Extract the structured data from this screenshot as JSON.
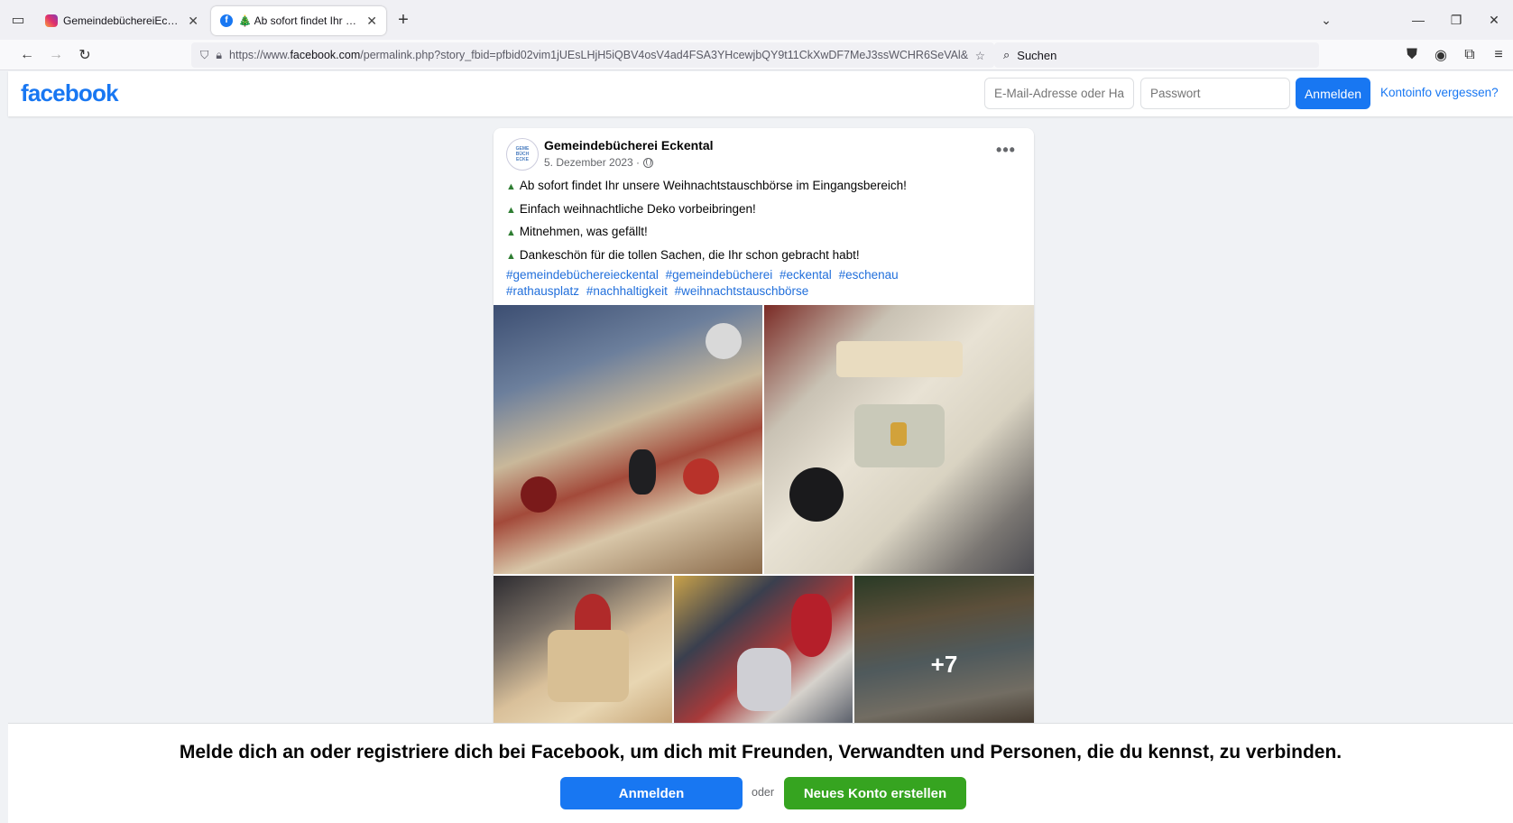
{
  "browser": {
    "tabs": [
      {
        "title": "GemeindebüchereiEckental | 🎄 ",
        "favicon": "instagram-icon",
        "active": false
      },
      {
        "title": "🎄 Ab sofort findet Ihr unsere...",
        "favicon": "facebook-icon",
        "active": true
      }
    ],
    "url_prefix": "https://www.",
    "url_domain": "facebook.com",
    "url_rest": "/permalink.php?story_fbid=pfbid02vim1jUEsLHjH5iQBV4osV4ad4FSA3YHcewjbQY9t11CkXwDF7MeJ3ssWCHR6SeVAl&id",
    "search_placeholder": "Suchen",
    "icons": {
      "tab_list": "tab-list-icon",
      "back": "back-arrow-icon",
      "forward": "forward-arrow-icon",
      "reload": "reload-icon",
      "shield": "shield-icon",
      "lock": "lock-icon",
      "bookmark": "star-icon",
      "search": "search-icon",
      "pocket": "pocket-icon",
      "account": "account-icon",
      "extensions": "puzzle-icon",
      "menu": "menu-icon"
    }
  },
  "fb_header": {
    "logo": "facebook",
    "email_placeholder": "E-Mail-Adresse oder Handynummer",
    "password_placeholder": "Passwort",
    "login_label": "Anmelden",
    "forgot_label": "Kontoinfo vergessen?"
  },
  "post": {
    "avatar_text": [
      "GEME",
      "BÜCH",
      "ECKE"
    ],
    "author": "Gemeindebücherei Eckental",
    "date": "5. Dezember 2023 ·",
    "more_label": "•••",
    "lines": [
      "Ab sofort findet Ihr unsere Weihnachtstauschbörse im Eingangsbereich!",
      "Einfach weihnachtliche Deko vorbeibringen!",
      "Mitnehmen, was gefällt!",
      "Dankeschön für die tollen Sachen, die Ihr schon gebracht habt!"
    ],
    "tree_glyph": "▲",
    "hashtags": [
      "#gemeindebüchereieckental",
      "#gemeindebücherei",
      "#eckental",
      "#eschenau",
      "#rathausplatz",
      "#nachhaltigkeit",
      "#weihnachtstauschbörse"
    ],
    "more_photos": "+7"
  },
  "banner": {
    "text": "Melde dich an oder registriere dich bei Facebook, um dich mit Freunden, Verwandten und Personen, die du kennst, zu verbinden.",
    "login_label": "Anmelden",
    "or_label": "oder",
    "register_label": "Neues Konto erstellen"
  },
  "colors": {
    "brand": "#1877f2",
    "register_green": "#36a420",
    "hashtag": "#216fdb"
  }
}
